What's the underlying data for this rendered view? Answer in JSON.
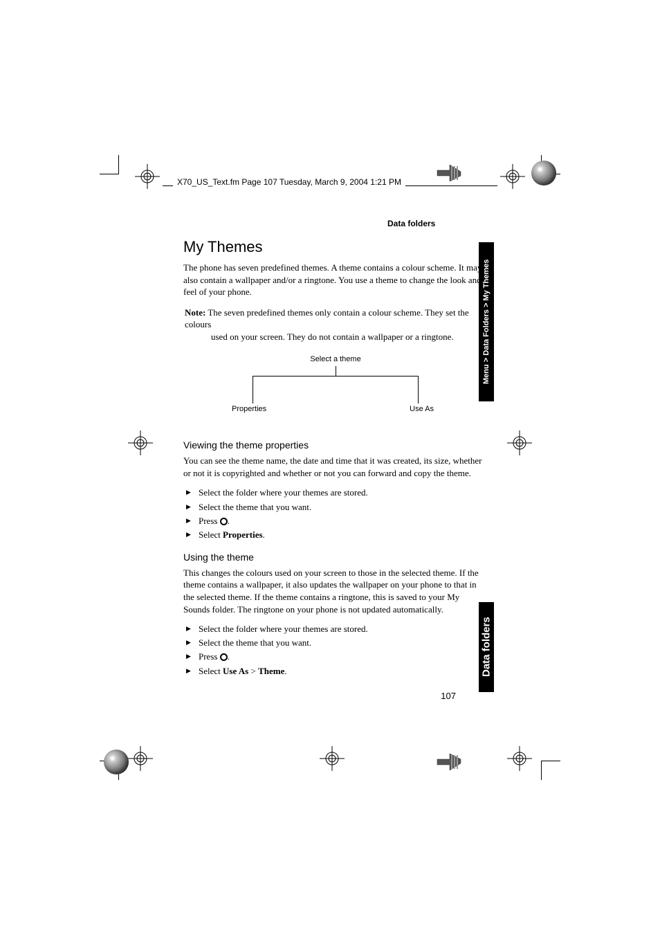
{
  "header": "X70_US_Text.fm  Page 107  Tuesday, March 9, 2004  1:21 PM",
  "section_label": "Data folders",
  "title": "My Themes",
  "intro": "The phone has seven predefined themes. A theme contains a colour scheme. It may also contain a wallpaper and/or a ringtone. You use a theme to change the look and feel of your phone.",
  "note_label": "Note:",
  "note_text_line1": " The seven predefined themes only contain a colour scheme. They set the colours",
  "note_text_line2": "used on your screen. They do not contain a wallpaper or a ringtone.",
  "diagram": {
    "top": "Select a theme",
    "left": "Properties",
    "right": "Use As"
  },
  "sub1_title": "Viewing the theme properties",
  "sub1_body": "You can see the theme name, the date and time that it was created, its size, whether or not it is copyrighted and whether or not you can forward and copy the theme.",
  "sub1_steps": {
    "s1": "Select the folder where your themes are stored.",
    "s2": "Select the theme that you want.",
    "s3a": "Press ",
    "s3b": ".",
    "s4a": "Select ",
    "s4b": "Properties",
    "s4c": "."
  },
  "sub2_title": "Using the theme",
  "sub2_body": "This changes the colours used on your screen to those in the selected theme. If the theme contains a wallpaper, it also updates the wallpaper on your phone to that in the selected theme. If the theme contains a ringtone, this is saved to your My Sounds folder. The ringtone on your phone is not updated automatically.",
  "sub2_steps": {
    "s1": "Select the folder where your themes are stored.",
    "s2": "Select the theme that you want.",
    "s3a": "Press ",
    "s3b": ".",
    "s4a": "Select ",
    "s4b": "Use As",
    "s4c": " > ",
    "s4d": "Theme",
    "s4e": "."
  },
  "side_tab_1": "Menu > Data Folders > My Themes",
  "side_tab_2": "Data folders",
  "page_number": "107"
}
